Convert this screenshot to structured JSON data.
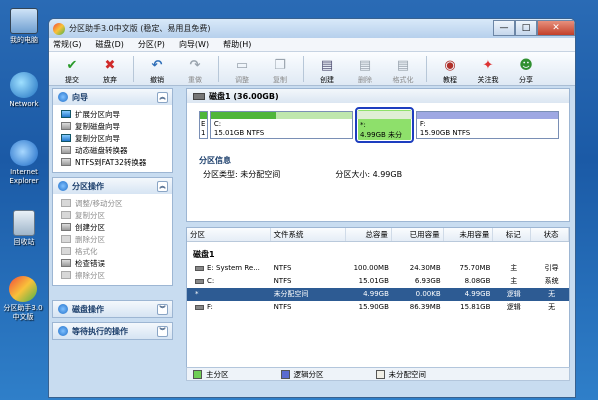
{
  "desktop": {
    "icons": [
      {
        "label": "我的电脑",
        "icon": "computer-icon"
      },
      {
        "label": "Network",
        "icon": "network-icon"
      },
      {
        "label": "Internet Explorer",
        "icon": "ie-icon"
      },
      {
        "label": "回收站",
        "icon": "recycle-bin-icon"
      },
      {
        "label": "分区助手3.0中文版",
        "icon": "partition-assistant-icon"
      }
    ]
  },
  "window": {
    "title": "分区助手3.0中文版 (稳定、易用且免费)",
    "controls": {
      "minimize": "—",
      "maximize": "□",
      "close": "✕"
    }
  },
  "menu": [
    "常规(G)",
    "磁盘(D)",
    "分区(P)",
    "向导(W)",
    "帮助(H)"
  ],
  "toolbar": [
    {
      "label": "提交",
      "icon": "check-icon",
      "enabled": true
    },
    {
      "label": "放弃",
      "icon": "discard-icon",
      "enabled": true
    },
    {
      "label": "撤销",
      "icon": "undo-icon",
      "enabled": true
    },
    {
      "label": "重做",
      "icon": "redo-icon",
      "enabled": false
    },
    {
      "label": "调整",
      "icon": "resize-icon",
      "enabled": false
    },
    {
      "label": "复制",
      "icon": "copy-icon",
      "enabled": false
    },
    {
      "label": "创建",
      "icon": "create-icon",
      "enabled": true
    },
    {
      "label": "删除",
      "icon": "delete-icon",
      "enabled": false
    },
    {
      "label": "格式化",
      "icon": "format-icon",
      "enabled": false
    },
    {
      "label": "教程",
      "icon": "tutorial-icon",
      "enabled": true
    },
    {
      "label": "关注我",
      "icon": "follow-icon",
      "enabled": true
    },
    {
      "label": "分享",
      "icon": "share-icon",
      "enabled": true
    }
  ],
  "left_panel": {
    "wizard": {
      "title": "向导",
      "items": [
        "扩展分区向导",
        "复制磁盘向导",
        "复制分区向导",
        "动态磁盘转换器",
        "NTFS到FAT32转换器"
      ]
    },
    "partition_ops": {
      "title": "分区操作",
      "items": [
        {
          "label": "调整/移动分区",
          "enabled": false
        },
        {
          "label": "复制分区",
          "enabled": false
        },
        {
          "label": "创建分区",
          "enabled": true
        },
        {
          "label": "删除分区",
          "enabled": false
        },
        {
          "label": "格式化",
          "enabled": false
        },
        {
          "label": "检查错误",
          "enabled": true
        },
        {
          "label": "擦除分区",
          "enabled": false
        }
      ]
    },
    "disk_ops": {
      "title": "磁盘操作"
    },
    "pending_ops": {
      "title": "等待执行的操作"
    }
  },
  "disk_map": {
    "title": "磁盘1 (36.00GB)",
    "partitions": [
      {
        "name": "E",
        "detail": "1",
        "fill": 0.9,
        "width_ratio": 0.025
      },
      {
        "name": "C:",
        "detail": "15.01GB NTFS",
        "fill": 0.46
      },
      {
        "name": "*:",
        "detail": "4.99GB 未分",
        "fill": 0.0,
        "selected": true
      },
      {
        "name": "F:",
        "detail": "15.90GB NTFS",
        "fill": 0.0
      }
    ]
  },
  "partition_info": {
    "heading": "分区信息",
    "type_label": "分区类型: 未分配空间",
    "size_label": "分区大小: 4.99GB"
  },
  "table": {
    "headers": [
      "分区",
      "文件系统",
      "总容量",
      "已用容量",
      "未用容量",
      "标记",
      "状态"
    ],
    "disk_label": "磁盘1",
    "rows": [
      {
        "name": "E: System Re...",
        "fs": "NTFS",
        "total": "100.00MB",
        "used": "24.30MB",
        "free": "75.70MB",
        "flag": "主",
        "status": "引导",
        "selected": false
      },
      {
        "name": "C:",
        "fs": "NTFS",
        "total": "15.01GB",
        "used": "6.93GB",
        "free": "8.08GB",
        "flag": "主",
        "status": "系统",
        "selected": false
      },
      {
        "name": "*",
        "fs": "未分配空间",
        "total": "4.99GB",
        "used": "0.00KB",
        "free": "4.99GB",
        "flag": "逻辑",
        "status": "无",
        "selected": true
      },
      {
        "name": "F:",
        "fs": "NTFS",
        "total": "15.90GB",
        "used": "86.39MB",
        "free": "15.81GB",
        "flag": "逻辑",
        "status": "无",
        "selected": false
      }
    ]
  },
  "legend": [
    {
      "label": "主分区",
      "color": "#6fcf55"
    },
    {
      "label": "逻辑分区",
      "color": "#5b6bd0"
    },
    {
      "label": "未分配空间",
      "color": "#f1efe6"
    }
  ]
}
